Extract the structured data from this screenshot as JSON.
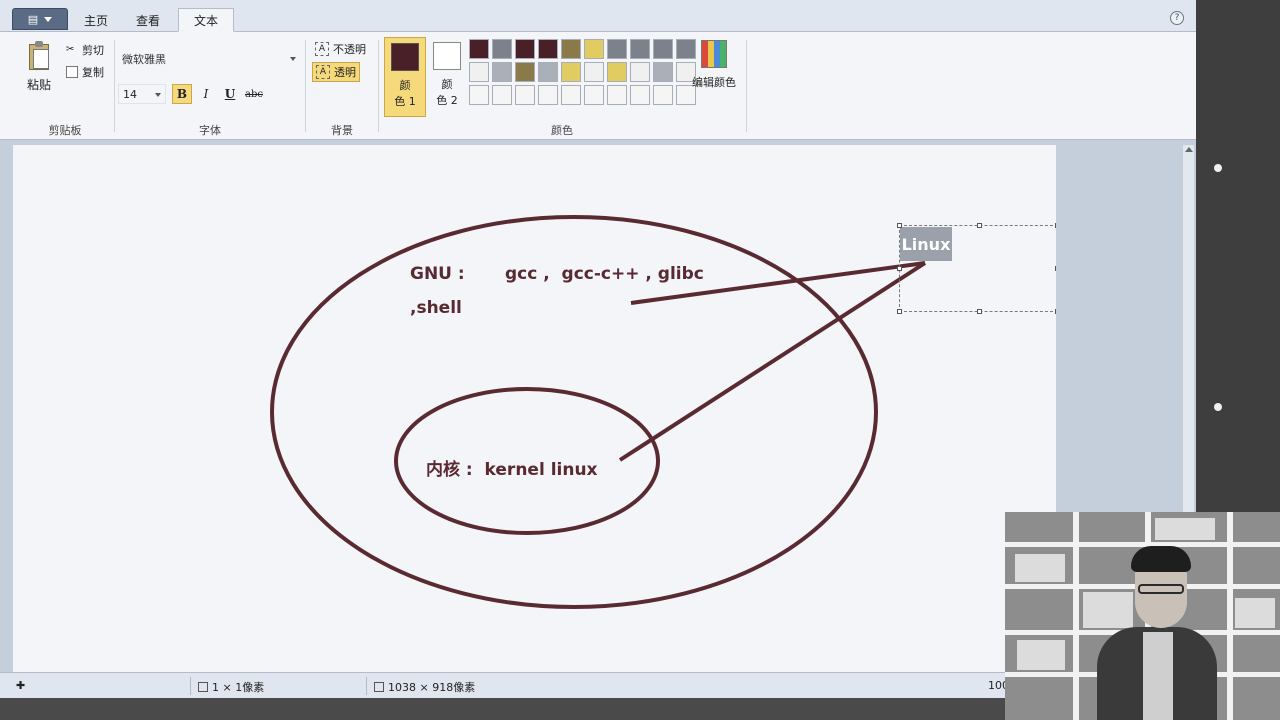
{
  "ribbon_tabs": {
    "file_icon": "menu-icon",
    "home": "主页",
    "view": "查看",
    "text": "文本"
  },
  "clipboard": {
    "paste": "粘贴",
    "cut": "剪切",
    "copy": "复制",
    "group_label": "剪贴板"
  },
  "font": {
    "family": "微软雅黑",
    "size": "14",
    "bold": "B",
    "italic": "I",
    "underline": "U",
    "strikethrough": "abc",
    "group_label": "字体"
  },
  "background": {
    "opaque": "不透明",
    "transparent": "透明",
    "group_label": "背景"
  },
  "colors": {
    "color1_label_a": "颜",
    "color1_label_b": "色 1",
    "color2_label_a": "颜",
    "color2_label_b": "色 2",
    "edit_colors": "编辑颜色",
    "group_label": "颜色",
    "color1": "#4a2028",
    "color2": "#ffffff",
    "palette_row1": [
      "#4a2028",
      "#7b828c",
      "#4a2028",
      "#4a2028",
      "#8a7a4a",
      "#e0cc60",
      "#7b828c",
      "#7b828c",
      "#7b828c",
      "#7b828c"
    ],
    "palette_row2": [
      "#f0f0f0",
      "#aab0b8",
      "#8a7a4a",
      "#aab0b8",
      "#e0cc60",
      "#f0f0f0",
      "#e0cc60",
      "#f0f0f0",
      "#aab0b8",
      "#f0f0f0"
    ],
    "palette_row3": [
      "#f5f5f5",
      "#f5f5f5",
      "#f5f5f5",
      "#f5f5f5",
      "#f5f5f5",
      "#f5f5f5",
      "#f5f5f5",
      "#f5f5f5",
      "#f5f5f5",
      "#f5f5f5"
    ]
  },
  "canvas": {
    "gnu_label": "GNU :",
    "gnu_tools": "gcc ,  gcc-c++ , glibc",
    "shell": ",shell",
    "kernel": "内核 :  kernel linux",
    "textbox": "Linux",
    "ink_color": "#5a2a32"
  },
  "status": {
    "cursor_pos": "1 × 1像素",
    "canvas_size": "1038 × 918像素",
    "zoom": "100"
  }
}
